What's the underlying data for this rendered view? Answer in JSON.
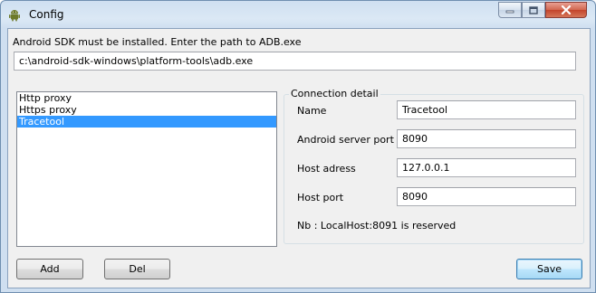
{
  "window": {
    "title": "Config",
    "controls": {
      "minimize": "minimize",
      "maximize": "maximize",
      "close": "close"
    }
  },
  "adb": {
    "instruction": "Android SDK must be installed. Enter the path to ADB.exe",
    "path_value": "c:\\android-sdk-windows\\platform-tools\\adb.exe"
  },
  "proxy_list": {
    "items": [
      "Http proxy",
      "Https proxy",
      "Tracetool"
    ],
    "selected": "Tracetool"
  },
  "connection_detail": {
    "group_title": "Connection detail",
    "name_label": "Name",
    "name_value": "Tracetool",
    "server_port_label": "Android server port",
    "server_port_value": "8090",
    "host_address_label": "Host adress",
    "host_address_value": "127.0.0.1",
    "host_port_label": "Host port",
    "host_port_value": "8090",
    "note": "Nb : LocalHost:8091 is reserved"
  },
  "buttons": {
    "add": "Add",
    "del": "Del",
    "save": "Save"
  },
  "colors": {
    "selection": "#3399ff",
    "client_bg": "#f0f0f0",
    "close_button": "#c3442b"
  },
  "icons": {
    "app": "android-robot-icon"
  }
}
